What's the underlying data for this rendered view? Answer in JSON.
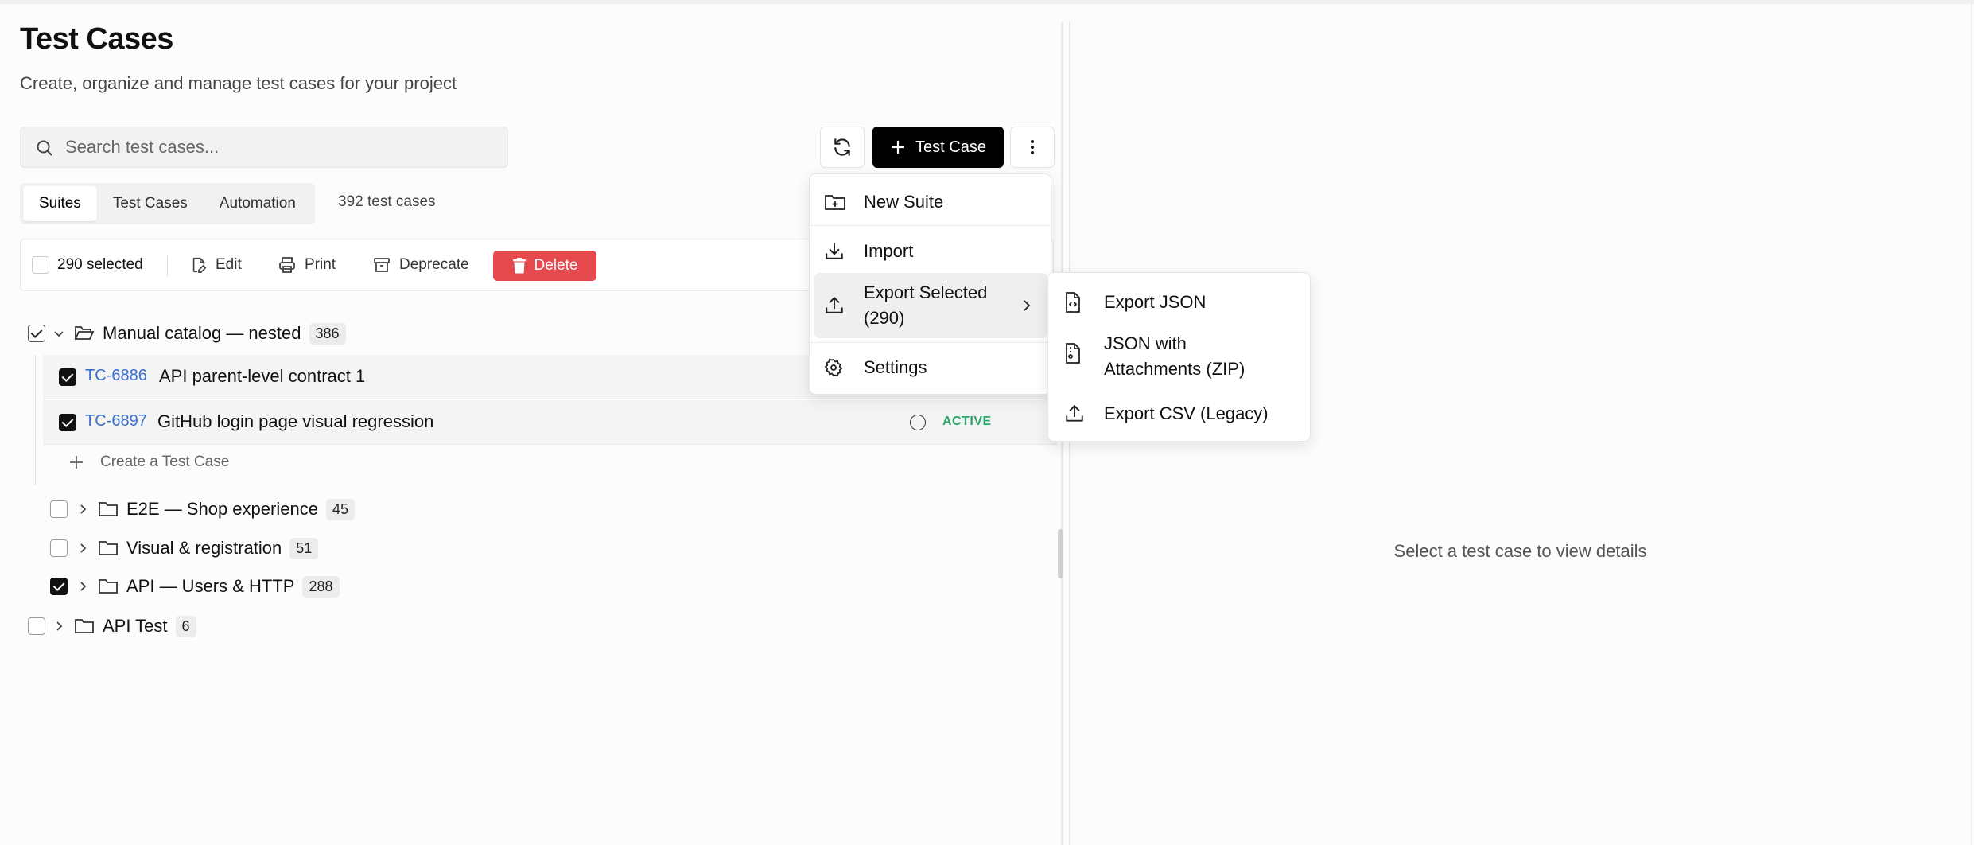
{
  "page": {
    "title": "Test Cases",
    "subtitle": "Create, organize and manage test cases for your project"
  },
  "search": {
    "placeholder": "Search test cases..."
  },
  "toolbar": {
    "new_test_case_label": "Test Case"
  },
  "tabs": [
    {
      "label": "Suites",
      "active": true
    },
    {
      "label": "Test Cases",
      "active": false
    },
    {
      "label": "Automation",
      "active": false
    }
  ],
  "total_count": "392 test cases",
  "actionbar": {
    "selected": "290 selected",
    "edit": "Edit",
    "print": "Print",
    "deprecate": "Deprecate",
    "delete": "Delete"
  },
  "tree": {
    "root": {
      "name": "Manual catalog — nested",
      "count": "386"
    },
    "cases": [
      {
        "id": "TC-6886",
        "title": "API parent-level contract 1"
      },
      {
        "id": "TC-6897",
        "title": "GitHub login page visual regression",
        "status": "ACTIVE"
      }
    ],
    "create_label": "Create a Test Case",
    "subsuites": [
      {
        "name": "E2E — Shop experience",
        "count": "45",
        "checked": false
      },
      {
        "name": "Visual & registration",
        "count": "51",
        "checked": false
      },
      {
        "name": "API — Users & HTTP",
        "count": "288",
        "checked": true
      }
    ],
    "other_suite": {
      "name": "API Test",
      "count": "6"
    }
  },
  "menu": {
    "new_suite": "New Suite",
    "import": "Import",
    "export_selected_line1": "Export Selected",
    "export_selected_line2": "(290)",
    "settings": "Settings"
  },
  "submenu": {
    "export_json": "Export JSON",
    "json_attach_line1": "JSON with",
    "json_attach_line2": "Attachments (ZIP)",
    "export_csv": "Export CSV (Legacy)"
  },
  "detail": {
    "empty": "Select a test case to view details"
  },
  "colors": {
    "accent_link": "#3b6fd1",
    "danger": "#e5484d",
    "active_status": "#2ea56a"
  }
}
